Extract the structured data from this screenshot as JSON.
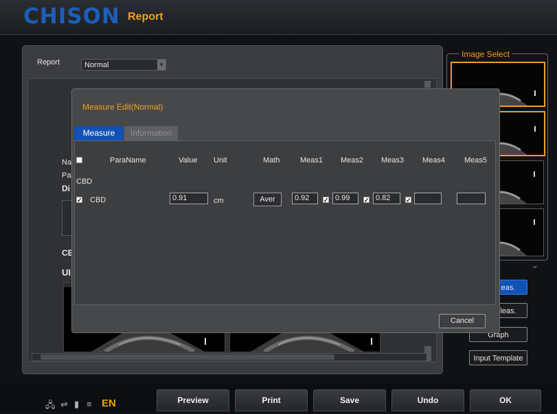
{
  "header": {
    "brand": "CHISON",
    "title": "Report"
  },
  "report": {
    "label": "Report",
    "selected": "Normal"
  },
  "background_fragments": {
    "na": "Na",
    "pa": "Pa",
    "di": "Di",
    "ce": "CE",
    "ul": "UI"
  },
  "image_select": {
    "title": "Image Select"
  },
  "side_buttons": {
    "meas1": "eas.",
    "meas2": "leas.",
    "graph": "Graph",
    "input_template": "Input Template"
  },
  "dialog": {
    "title": "Measure Edit(Normal)",
    "tabs": [
      "Measure",
      "Information"
    ],
    "columns": {
      "paraname": "ParaName",
      "value": "Value",
      "unit": "Unit",
      "math": "Math",
      "meas1": "Meas1",
      "meas2": "Meas2",
      "meas3": "Meas3",
      "meas4": "Meas4",
      "meas5": "Meas5"
    },
    "group": "CBD",
    "row": {
      "name": "CBD",
      "value": "0.91",
      "unit": "cm",
      "math": "Aver",
      "meas1": "0.92",
      "meas2": "0.99",
      "meas3": "0.82",
      "meas4": "",
      "meas5": ""
    },
    "cancel": "Cancel"
  },
  "bottom": {
    "lang": "EN",
    "buttons": [
      "Preview",
      "Print",
      "Save",
      "Undo",
      "OK"
    ]
  },
  "colors": {
    "accent": "#f0a020",
    "selected_blue": "#1252b6",
    "brand_blue": "#1b5fb8"
  }
}
